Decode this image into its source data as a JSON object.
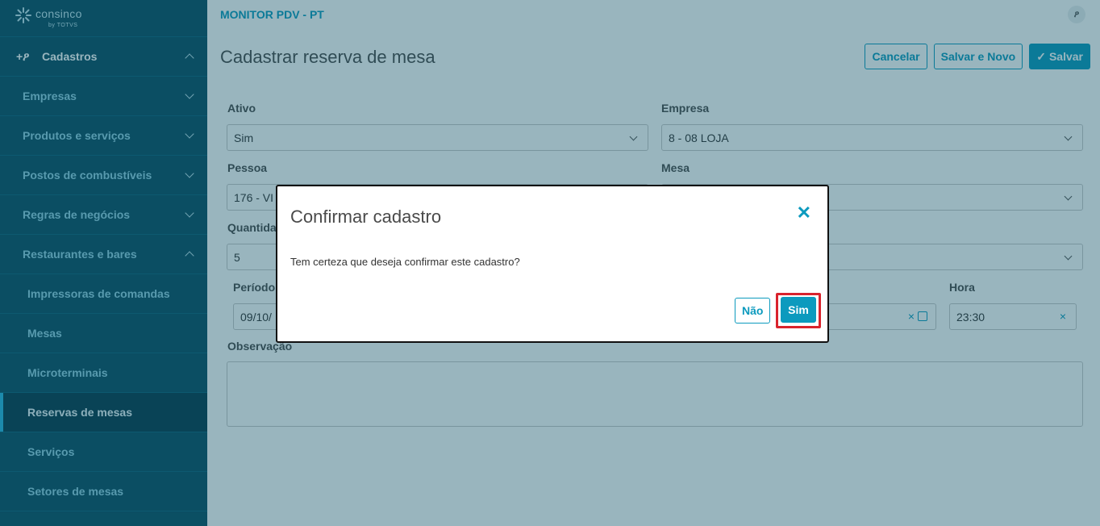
{
  "brand": {
    "name": "consinco",
    "sub": "by TOTVS",
    "accent": "#0c9abe",
    "sidebar_bg": "#0b4f63"
  },
  "sidebar": {
    "section": {
      "label": "Cadastros",
      "icon": "add-user-icon"
    },
    "items": [
      {
        "label": "Empresas"
      },
      {
        "label": "Produtos e serviços"
      },
      {
        "label": "Postos de combustíveis"
      },
      {
        "label": "Regras de negócios"
      },
      {
        "label": "Restaurantes e bares"
      }
    ],
    "subitems": [
      {
        "label": "Impressoras de comandas"
      },
      {
        "label": "Mesas"
      },
      {
        "label": "Microterminais"
      },
      {
        "label": "Reservas de mesas"
      },
      {
        "label": "Serviços"
      },
      {
        "label": "Setores de mesas"
      }
    ]
  },
  "header": {
    "app_title": "MONITOR PDV - PT",
    "user_icon": "user-icon"
  },
  "page": {
    "title": "Cadastrar reserva de mesa",
    "actions": {
      "cancel": "Cancelar",
      "save_new": "Salvar e Novo",
      "save": "Salvar"
    }
  },
  "form": {
    "ativo": {
      "label": "Ativo",
      "value": "Sim"
    },
    "empresa": {
      "label": "Empresa",
      "value": "8 - 08 LOJA"
    },
    "pessoa": {
      "label": "Pessoa",
      "value": "176 - VI"
    },
    "mesa": {
      "label": "Mesa",
      "value": ""
    },
    "quantidade": {
      "label": "Quantida",
      "value": "5"
    },
    "periodo": {
      "label": "Período",
      "value": "09/10/"
    },
    "hora": {
      "label": "Hora",
      "value": "23:30"
    },
    "observacao": {
      "label": "Observação",
      "value": ""
    }
  },
  "modal": {
    "title": "Confirmar cadastro",
    "message": "Tem certeza que deseja confirmar este cadastro?",
    "no_label": "Não",
    "yes_label": "Sim",
    "close_icon": "close-icon",
    "highlight_color": "#d9232d"
  }
}
